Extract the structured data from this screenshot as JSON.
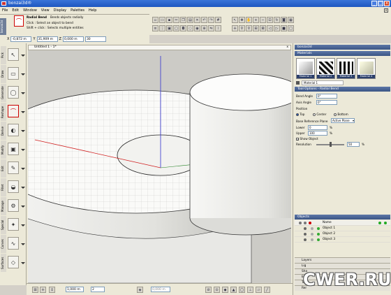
{
  "window": {
    "title": "bonzai3d®",
    "min": "_",
    "max": "□",
    "close": "x"
  },
  "menu": [
    "File",
    "Edit",
    "Window",
    "View",
    "Display",
    "Palettes",
    "Help"
  ],
  "tool_info": {
    "panel_label": "bonzai3d",
    "name": "Radial Bend",
    "description": "Bends objects radially",
    "hint1": "Click : Select an object to bend",
    "hint2": "Shift + click : Selects multiple entities"
  },
  "coords": {
    "x_label": "X",
    "x": "-0,872 m",
    "y_label": "Y",
    "y": "31,909 m",
    "z_label": "Z",
    "z": "0,000 m",
    "extra": "30"
  },
  "left_tools": [
    {
      "cat": "Pick",
      "icon": "pointer-icon",
      "glyph": "↖"
    },
    {
      "cat": "Draw",
      "icon": "rectangle-icon",
      "glyph": "▭"
    },
    {
      "cat": "Generate",
      "icon": "cylinder-icon",
      "glyph": "◯"
    },
    {
      "cat": "Reshape",
      "icon": "bend-icon",
      "glyph": "⌒"
    },
    {
      "cat": "Derive",
      "icon": "derive-icon",
      "glyph": "◐"
    },
    {
      "cat": "Modify",
      "icon": "modify-icon",
      "glyph": "▣"
    },
    {
      "cat": "Edit",
      "icon": "edit-icon",
      "glyph": "✎"
    },
    {
      "cat": "Fillet",
      "icon": "fillet-icon",
      "glyph": "◒"
    },
    {
      "cat": "Manage",
      "icon": "manage-icon",
      "glyph": "⚙"
    },
    {
      "cat": "Special",
      "icon": "special-icon",
      "glyph": "✦"
    },
    {
      "cat": "Curves",
      "icon": "curves-icon",
      "glyph": "∿"
    },
    {
      "cat": "Surfaces",
      "icon": "surfaces-icon",
      "glyph": "◇"
    }
  ],
  "viewport": {
    "tab_label": "Untitled 1 - 1*"
  },
  "status": {
    "distance": "1,000 m",
    "angle": "2",
    "snap": "0,000 m"
  },
  "colors": {
    "accent": "#1e56c0",
    "panel_header": "#3b5585",
    "ground": "#cccbc6",
    "axis_red": "#d02020",
    "axis_blue": "#3030d0",
    "axis_green": "#208020"
  },
  "right_panel": {
    "title": "bonzai3d",
    "materials_header": "Materials",
    "materials": [
      "Material 1",
      "Material 2",
      "Material 3",
      "Material 4"
    ],
    "current_material": "Material 1",
    "tool_options_header": "Tool Options - Radial Bend",
    "bend_angle_label": "Bend Angle",
    "bend_angle": "0°",
    "axis_angle_label": "Axis Angle",
    "axis_angle": "0°",
    "position_label": "Position",
    "pos_top": "Top",
    "pos_center": "Center",
    "pos_bottom": "Bottom",
    "base_ref_label": "Base Reference Plane",
    "base_ref_value": "Active Plane",
    "lower_label": "Lower",
    "lower": "0",
    "lower_unit": "%",
    "upper_label": "Upper",
    "upper": "100",
    "upper_unit": "%",
    "show_object": "Show Object",
    "resolution_label": "Resolution",
    "resolution": "50",
    "resolution_unit": "%",
    "resolution_level": 0.5,
    "objects_header": "Objects",
    "objects_col": "Name",
    "objects": [
      "Object 1",
      "Object 2",
      "Object 3"
    ],
    "layers_header": "Layers",
    "collapsed": [
      "Lig",
      "Sha",
      "Env",
      "Ten",
      "Rer"
    ]
  },
  "watermark": "CWER.RU"
}
